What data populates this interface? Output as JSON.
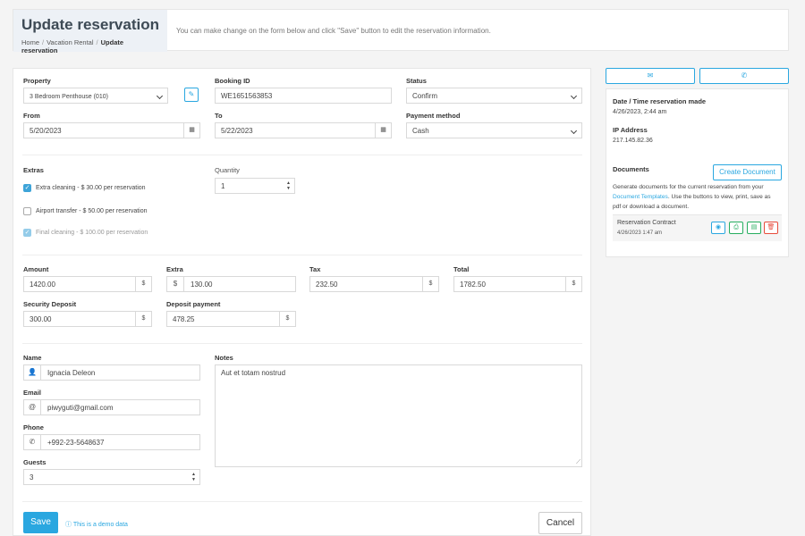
{
  "header": {
    "title": "Update reservation",
    "breadcrumb": [
      "Home",
      "Vacation Rental",
      "Update reservation"
    ],
    "description": "You can make change on the form below and click \"Save\" button to edit the reservation information."
  },
  "form": {
    "property": {
      "label": "Property",
      "value": "3 Bedroom Penthouse (010)"
    },
    "booking_id": {
      "label": "Booking ID",
      "value": "WE1651563853"
    },
    "status": {
      "label": "Status",
      "value": "Confirm"
    },
    "from": {
      "label": "From",
      "value": "5/20/2023"
    },
    "to": {
      "label": "To",
      "value": "5/22/2023"
    },
    "payment_method": {
      "label": "Payment method",
      "value": "Cash"
    },
    "extras": {
      "label": "Extras",
      "items": [
        {
          "label": "Extra cleaning - $ 30.00 per reservation",
          "checked": true,
          "disabled": false
        },
        {
          "label": "Airport transfer - $ 50.00 per reservation",
          "checked": false,
          "disabled": false
        },
        {
          "label": "Final cleaning - $ 100.00 per reservation",
          "checked": true,
          "disabled": true
        }
      ]
    },
    "quantity": {
      "label": "Quantity",
      "value": "1"
    },
    "amount": {
      "label": "Amount",
      "value": "1420.00",
      "addon": "$"
    },
    "extra": {
      "label": "Extra",
      "value": "130.00",
      "addon": "$"
    },
    "tax": {
      "label": "Tax",
      "value": "232.50",
      "addon": "$"
    },
    "total": {
      "label": "Total",
      "value": "1782.50",
      "addon": "$"
    },
    "security_deposit": {
      "label": "Security Deposit",
      "value": "300.00",
      "addon": "$"
    },
    "deposit_payment": {
      "label": "Deposit payment",
      "value": "478.25",
      "addon": "$"
    },
    "name": {
      "label": "Name",
      "value": "Ignacia Deleon"
    },
    "email": {
      "label": "Email",
      "value": "piwyguti@gmail.com",
      "addon": "@"
    },
    "phone": {
      "label": "Phone",
      "value": "+992-23-5648637"
    },
    "guests": {
      "label": "Guests",
      "value": "3"
    },
    "notes": {
      "label": "Notes",
      "value": "Aut et totam nostrud"
    },
    "save_label": "Save",
    "demo_note": "This is a demo data",
    "cancel_label": "Cancel"
  },
  "sidebar": {
    "date_label": "Date / Time reservation made",
    "date_value": "4/26/2023, 2:44 am",
    "ip_label": "IP Address",
    "ip_value": "217.145.82.36",
    "documents_label": "Documents",
    "create_doc_label": "Create Document",
    "doc_help_1": "Generate documents for the current reservation from your",
    "doc_help_link": "Document Templates",
    "doc_help_2": ". Use the buttons to view, print, save as pdf or download a document.",
    "doc": {
      "name": "Reservation Contract",
      "date": "4/26/2023 1:47 am"
    }
  },
  "colors": {
    "accent": "#2aa7e0",
    "success": "#27ae60",
    "danger": "#e74c3c"
  }
}
